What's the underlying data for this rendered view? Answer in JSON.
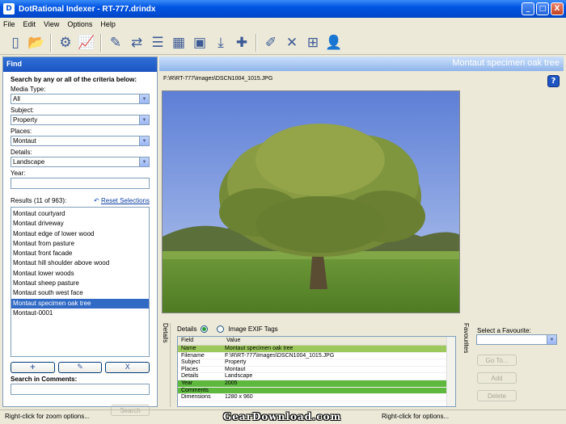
{
  "window": {
    "title": "DotRational Indexer - RT-777.drindx",
    "min": "_",
    "max": "□",
    "close": "X"
  },
  "menu": [
    "File",
    "Edit",
    "View",
    "Options",
    "Help"
  ],
  "toolbar_icons": [
    "new-icon",
    "open-icon",
    "settings-icon",
    "chart-icon",
    "tag-icon",
    "refresh-icon",
    "list-icon",
    "grid-icon",
    "camera-icon",
    "import-icon",
    "add-icon",
    "edit-icon",
    "delete-icon",
    "thumbnails-icon",
    "user-icon"
  ],
  "find": {
    "header": "Find",
    "instructions": "Search by any or all of the criteria below:",
    "media_type_label": "Media Type:",
    "media_type_value": "All",
    "subject_label": "Subject:",
    "subject_value": "Property",
    "places_label": "Places:",
    "places_value": "Montaut",
    "details_label": "Details:",
    "details_value": "Landscape",
    "year_label": "Year:",
    "year_value": "",
    "results_label": "Results (11 of 963):",
    "reset_label": "Reset Selections",
    "results": [
      "Montaut courtyard",
      "Montaut driveway",
      "Montaut edge of lower wood",
      "Montaut from pasture",
      "Montaut front facade",
      "Montaut hill shoulder above wood",
      "Montaut lower woods",
      "Montaut sheep pasture",
      "Montaut south west face",
      "Montaut specimen oak tree",
      "Montaut-0001"
    ],
    "selected_index": 9,
    "add_symbol": "+",
    "edit_symbol": "✎",
    "delete_symbol": "X",
    "comments_label": "Search in Comments:",
    "comments_value": "",
    "search_button": "Search"
  },
  "main": {
    "header": "Montaut specimen oak tree",
    "path": "F:\\R\\RT-777\\Images\\DSCN1004_1015.JPG",
    "help": "?"
  },
  "details": {
    "tab_label": "Details",
    "radio_details": "Details",
    "radio_exif": "Image EXIF Tags",
    "col_field": "Field",
    "col_value": "Value",
    "rows": [
      {
        "field": "Name",
        "value": "Montaut specimen oak tree"
      },
      {
        "field": "Filename",
        "value": "F:\\R\\RT-777\\Images\\DSCN1004_1015.JPG"
      },
      {
        "field": "Subject",
        "value": "Property"
      },
      {
        "field": "Places",
        "value": "Montaut"
      },
      {
        "field": "Details",
        "value": "Landscape"
      },
      {
        "field": "Year",
        "value": "2005"
      },
      {
        "field": "Comments",
        "value": ""
      },
      {
        "field": "Dimensions",
        "value": "1280 x 960"
      }
    ]
  },
  "favourites": {
    "tab_label": "Favourites",
    "select_label": "Select a Favourite:",
    "goto": "Go To...",
    "add": "Add",
    "delete": "Delete"
  },
  "status": {
    "left": "Right-click for zoom options...",
    "right": "Right-click for options...",
    "watermark": "GearDownload.com"
  }
}
